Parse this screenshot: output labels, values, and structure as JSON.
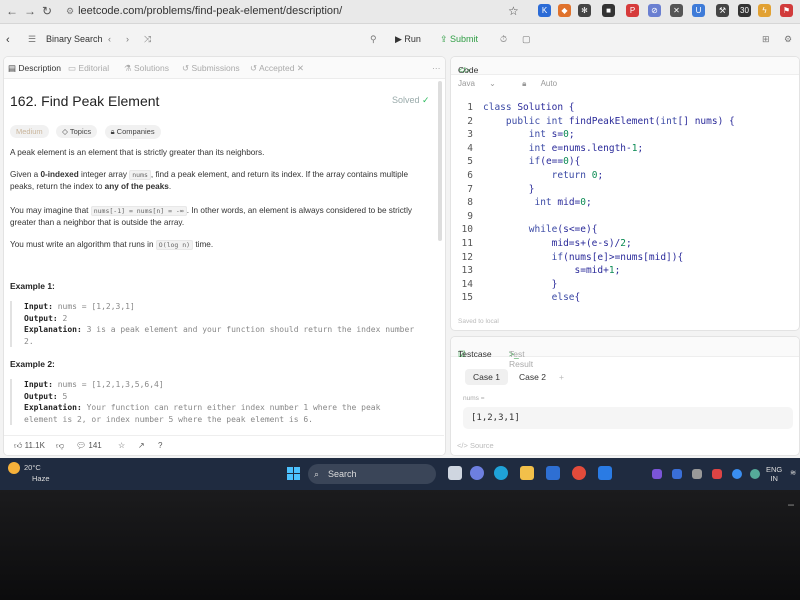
{
  "browser": {
    "url": "leetcode.com/problems/find-peak-element/description/"
  },
  "toolbar": {
    "list_label": "Binary Search",
    "run_label": "Run",
    "submit_label": "Submit"
  },
  "tabs": [
    {
      "label": "Description"
    },
    {
      "label": "Editorial"
    },
    {
      "label": "Solutions"
    },
    {
      "label": "Submissions"
    },
    {
      "label": "Accepted"
    }
  ],
  "problem": {
    "title": "162. Find Peak Element",
    "status": "Solved",
    "difficulty": "Medium",
    "tag_topics": "Topics",
    "tag_companies": "Companies",
    "p1": "A peak element is an element that is strictly greater than its neighbors.",
    "p2_a": "Given a ",
    "p2_b": "0-indexed",
    "p2_c": " integer array ",
    "p2_code": "nums",
    "p2_d": ", find a peak element, and return its index. If the array contains multiple peaks, return the index to ",
    "p2_e": "any of the peaks",
    "p2_f": ".",
    "p3_a": "You may imagine that ",
    "p3_code1": "nums[-1] = nums[n] = -∞",
    "p3_b": ". In other words, an element is always considered to be strictly greater than a neighbor that is outside the array.",
    "p4_a": "You must write an algorithm that runs in ",
    "p4_code": "O(log n)",
    "p4_b": " time.",
    "ex1_title": "Example 1:",
    "ex1_input_label": "Input:",
    "ex1_input": " nums = [1,2,3,1]",
    "ex1_output_label": "Output:",
    "ex1_output": " 2",
    "ex1_expl_label": "Explanation:",
    "ex1_expl": " 3 is a peak element and your function should return the index number",
    "ex1_expl2": "2.",
    "ex2_title": "Example 2:",
    "ex2_input_label": "Input:",
    "ex2_input": " nums = [1,2,1,3,5,6,4]",
    "ex2_output_label": "Output:",
    "ex2_output": " 5",
    "ex2_expl_label": "Explanation:",
    "ex2_expl": " Your function can return either index number 1 where the peak",
    "ex2_expl2": "element is 2, or index number 5 where the peak element is 6."
  },
  "footer": {
    "likes": "11.1K",
    "comments": "141"
  },
  "editor": {
    "header": "Code",
    "language": "Java",
    "mode": "Auto",
    "saved_text": "Saved to local",
    "lines": [
      {
        "n": "1",
        "t": "class Solution {"
      },
      {
        "n": "2",
        "t": "    public int findPeakElement(int[] nums) {"
      },
      {
        "n": "3",
        "t": "        int s=0;"
      },
      {
        "n": "4",
        "t": "        int e=nums.length-1;"
      },
      {
        "n": "5",
        "t": "        if(e==0){"
      },
      {
        "n": "6",
        "t": "            return 0;"
      },
      {
        "n": "7",
        "t": "        }"
      },
      {
        "n": "8",
        "t": "         int mid=0;"
      },
      {
        "n": "9",
        "t": ""
      },
      {
        "n": "10",
        "t": "        while(s<=e){"
      },
      {
        "n": "11",
        "t": "            mid=s+(e-s)/2;"
      },
      {
        "n": "12",
        "t": "            if(nums[e]>=nums[mid]){"
      },
      {
        "n": "13",
        "t": "                s=mid+1;"
      },
      {
        "n": "14",
        "t": "            }"
      },
      {
        "n": "15",
        "t": "            else{"
      }
    ]
  },
  "testpanel": {
    "testcase_label": "Testcase",
    "result_label": "Test Result",
    "case1": "Case 1",
    "case2": "Case 2",
    "nums_label": "nums =",
    "nums_value": "[1,2,3,1]",
    "source_label": "Source"
  },
  "taskbar": {
    "temp": "20°C",
    "weather": "Haze",
    "search": "Search",
    "lang1": "ENG",
    "lang2": "IN"
  },
  "colors": {
    "accent_green": "#2f9e44",
    "taskbar": "#1f2b40",
    "keyword": "#3b4aa5"
  }
}
